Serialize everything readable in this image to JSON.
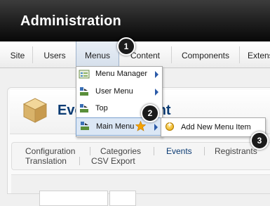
{
  "header": {
    "title": "Administration"
  },
  "menubar": {
    "items": [
      "Site",
      "Users",
      "Menus",
      "Content",
      "Components",
      "Extens"
    ]
  },
  "page": {
    "title_left": "Eve",
    "title_right": "ent"
  },
  "dropdown": {
    "items": [
      {
        "label": "Menu Manager",
        "icon": "menu-manager-icon",
        "has_submenu": true
      },
      {
        "label": "User Menu",
        "icon": "menu-icon",
        "has_submenu": true
      },
      {
        "label": "Top",
        "icon": "menu-icon",
        "has_submenu": true
      },
      {
        "label": "Main Menu",
        "icon": "menu-icon",
        "has_submenu": false,
        "highlighted": true,
        "starred": true
      }
    ]
  },
  "flyout": {
    "item_label": "Add New Menu Item",
    "icon": "add-icon"
  },
  "tabs": {
    "row1": [
      "Configuration",
      "Categories",
      "Events",
      "Registrants"
    ],
    "row2": [
      "Translation",
      "CSV Export"
    ],
    "active": "Events"
  },
  "badges": [
    "1",
    "2",
    "3"
  ],
  "colors": {
    "header_bg": "#1e1e1e",
    "title_blue": "#0b3b73",
    "active_tab": "#0b3b73",
    "star": "#f5a300"
  }
}
